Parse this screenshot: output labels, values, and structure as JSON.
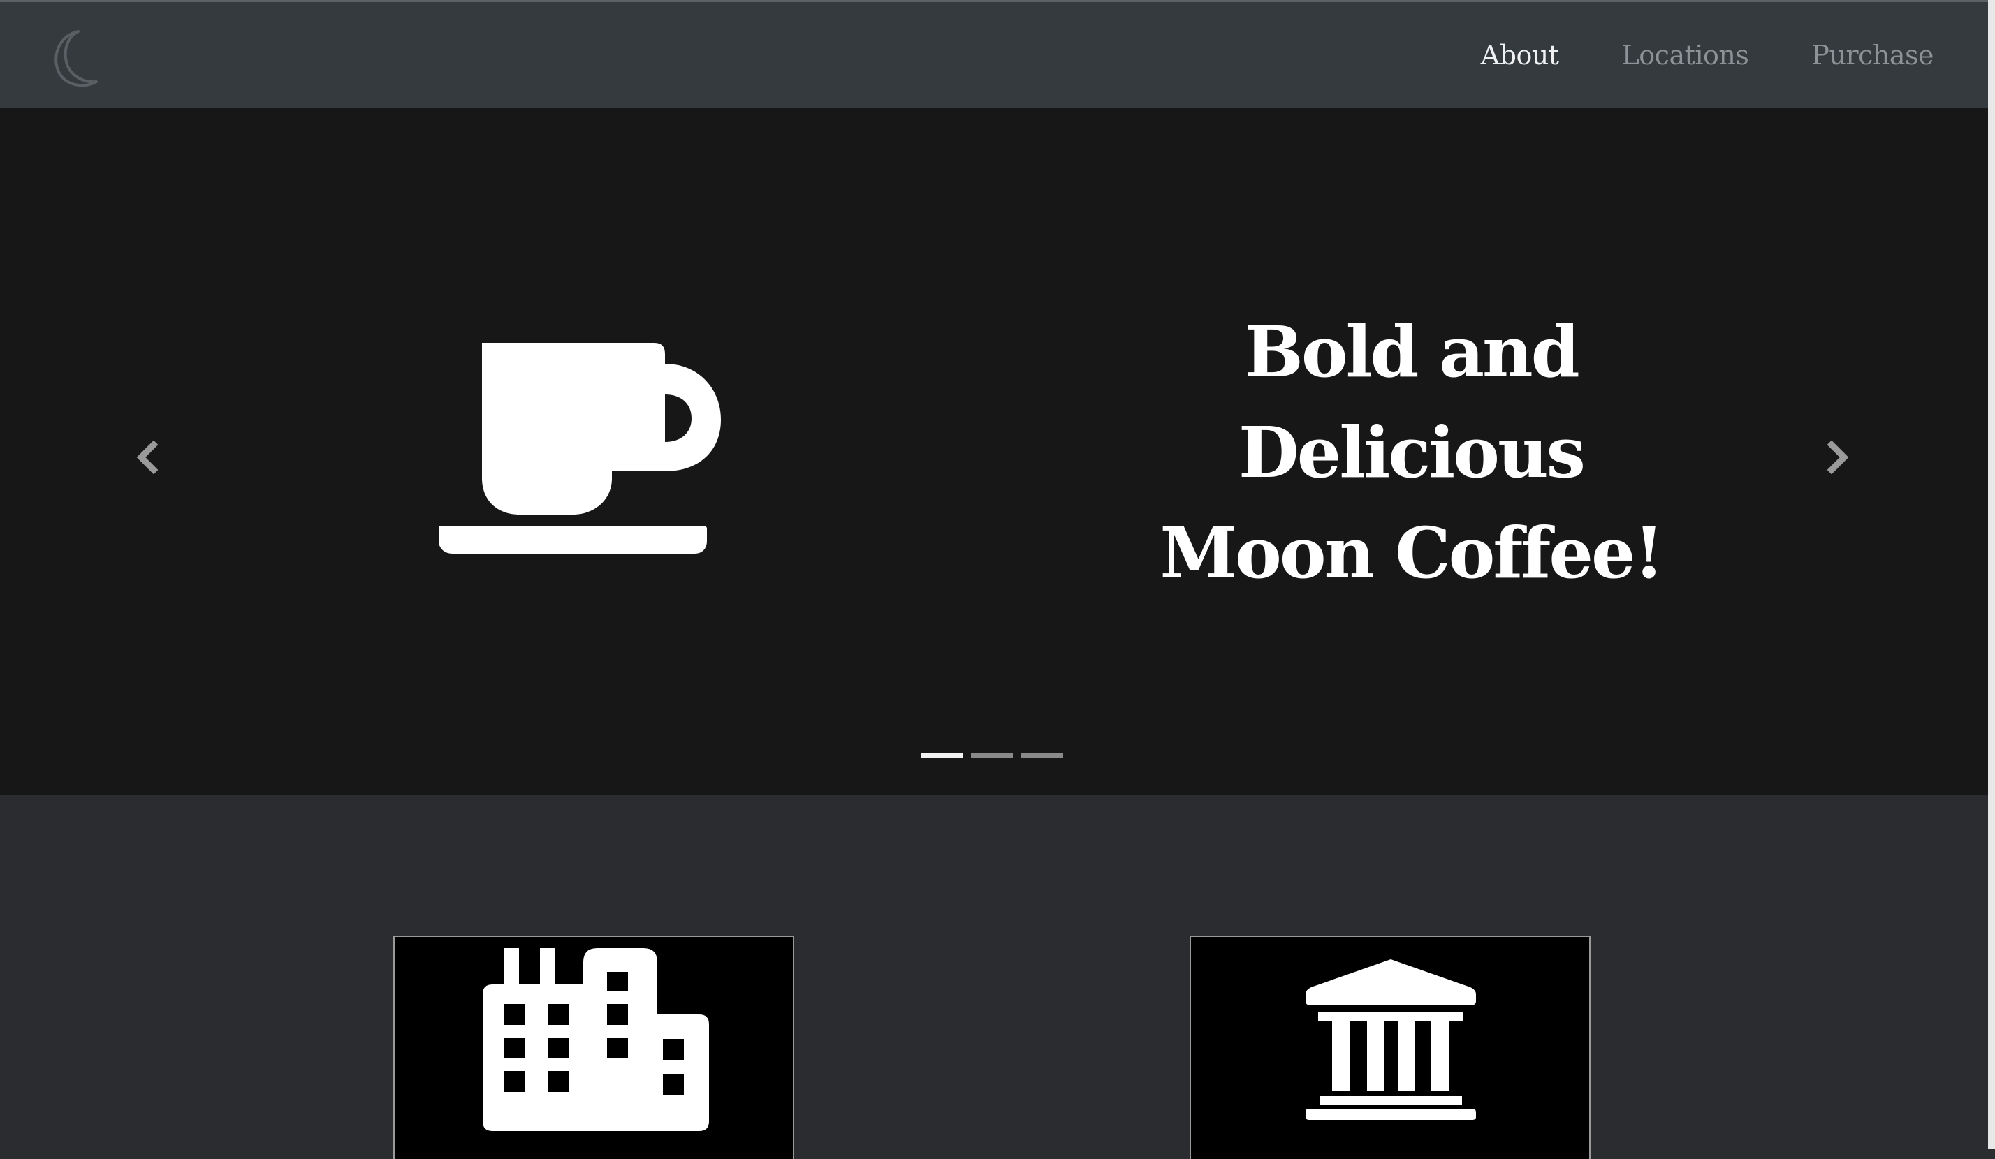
{
  "nav": {
    "brand_icon": "crescent-moon-icon",
    "links": [
      {
        "label": "About",
        "active": true
      },
      {
        "label": "Locations",
        "active": false
      },
      {
        "label": "Purchase",
        "active": false
      }
    ]
  },
  "carousel": {
    "slide_icon": "coffee-cup-icon",
    "headline_lines": [
      "Bold and",
      "Delicious",
      "Moon Coffee!"
    ],
    "prev_icon": "chevron-left-icon",
    "next_icon": "chevron-right-icon",
    "indicator_count": 3,
    "active_indicator": 0
  },
  "features": [
    {
      "icon": "factory-building-icon"
    },
    {
      "icon": "bank-building-icon"
    }
  ],
  "colors": {
    "navbar": "#353a3f",
    "carousel_bg": "#171717",
    "page_bg": "#2b2c2f",
    "active_link": "#eef0f2",
    "inactive_link": "#8e9296"
  }
}
